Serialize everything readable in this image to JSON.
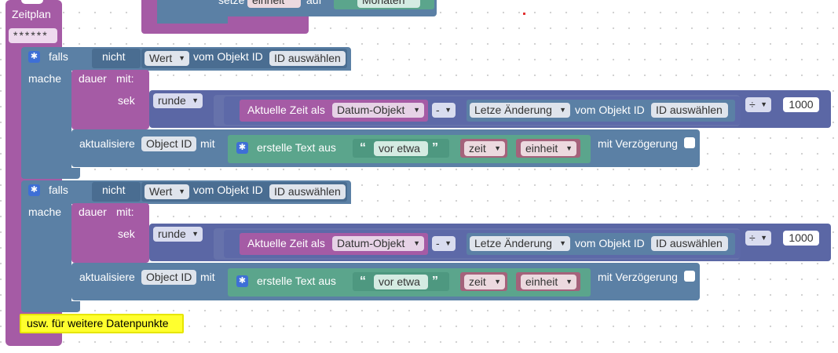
{
  "top": {
    "setze_label": "setze",
    "einheit_label": "einheit",
    "auf_label": "auf",
    "monaten_label": "Monaten"
  },
  "schedule": {
    "title": "Zeitplan",
    "value": "******"
  },
  "blocks": [
    {
      "if_label": "falls",
      "not_label": "nicht",
      "value_dropdown": "Wert",
      "from_object_label": "vom Objekt ID",
      "select_id": "ID auswählen",
      "do_label": "mache",
      "duration_label": "dauer",
      "with_label": "mit:",
      "sec_label": "sek",
      "round_dropdown": "runde",
      "current_time_label": "Aktuelle Zeit als",
      "date_object_dropdown": "Datum-Objekt",
      "minus_dropdown": "-",
      "last_change_dropdown": "Letze Änderung",
      "from_object_label2": "vom Objekt ID",
      "select_id2": "ID auswählen",
      "divide_dropdown": "÷",
      "divisor": "1000",
      "update_label": "aktualisiere",
      "object_id_label": "Object ID",
      "with2_label": "mit",
      "create_text_label": "erstelle Text aus",
      "text_value": "vor etwa",
      "var_zeit": "zeit",
      "var_einheit": "einheit",
      "delay_label": "mit Verzögerung"
    },
    {
      "if_label": "falls",
      "not_label": "nicht",
      "value_dropdown": "Wert",
      "from_object_label": "vom Objekt ID",
      "select_id": "ID auswählen",
      "do_label": "mache",
      "duration_label": "dauer",
      "with_label": "mit:",
      "sec_label": "sek",
      "round_dropdown": "runde",
      "current_time_label": "Aktuelle Zeit als",
      "date_object_dropdown": "Datum-Objekt",
      "minus_dropdown": "-",
      "last_change_dropdown": "Letze Änderung",
      "from_object_label2": "vom Objekt ID",
      "select_id2": "ID auswählen",
      "divide_dropdown": "÷",
      "divisor": "1000",
      "update_label": "aktualisiere",
      "object_id_label": "Object ID",
      "with2_label": "mit",
      "create_text_label": "erstelle Text aus",
      "text_value": "vor etwa",
      "var_zeit": "zeit",
      "var_einheit": "einheit",
      "delay_label": "mit Verzögerung"
    }
  ],
  "comment": {
    "text": "usw. für weitere Datenpunkte"
  },
  "icons": {
    "gear": "gear-icon",
    "dropdown": "dropdown-arrow-icon",
    "quote_open": "“",
    "quote_close": "”",
    "arrow": "▼"
  },
  "colors": {
    "schedule": "#a55ba5",
    "logic": "#5b80a5",
    "text": "#5ba58c",
    "variable": "#a5627b",
    "math": "#5b67a5",
    "comment": "#ffff00"
  }
}
